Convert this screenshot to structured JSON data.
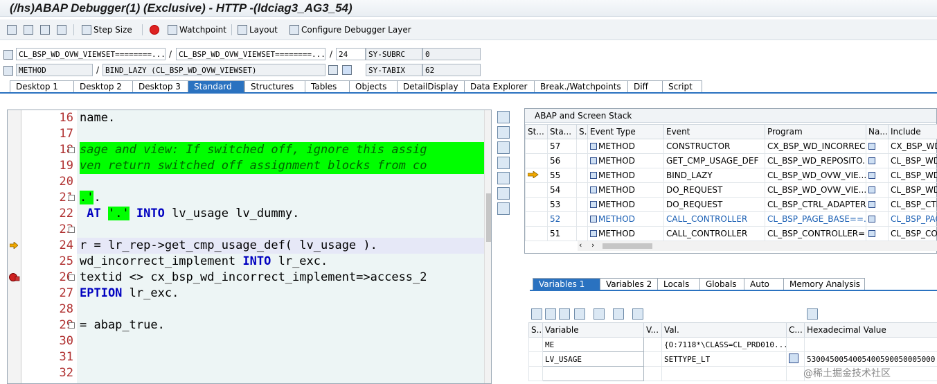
{
  "window": {
    "title": "(/hs)ABAP Debugger(1)  (Exclusive) - HTTP -(ldciag3_AG3_54)"
  },
  "toolbar": {
    "step_size": "Step Size",
    "watchpoint": "Watchpoint",
    "layout": "Layout",
    "configure": "Configure Debugger Layer"
  },
  "context": {
    "program_1": "CL_BSP_WD_OVW_VIEWSET========...",
    "program_2": "CL_BSP_WD_OVW_VIEWSET========...",
    "line": "24",
    "type": "METHOD",
    "name": "BIND_LAZY (CL_BSP_WD_OVW_VIEWSET)",
    "sysvars": [
      {
        "name": "SY-SUBRC",
        "value": "0"
      },
      {
        "name": "SY-TABIX",
        "value": "62"
      }
    ]
  },
  "tabs": [
    "Desktop 1",
    "Desktop 2",
    "Desktop 3",
    "Standard",
    "Structures",
    "Tables",
    "Objects",
    "DetailDisplay",
    "Data Explorer",
    "Break./Watchpoints",
    "Diff",
    "Script"
  ],
  "selected_tab": "Standard",
  "source": {
    "lines": [
      "16",
      "17",
      "18",
      "19",
      "20",
      "21",
      "22",
      "23",
      "24",
      "25",
      "26",
      "27",
      "28",
      "29",
      "30",
      "31",
      "32"
    ],
    "code": {
      "l16": "name.",
      "l18": "sage and view: If switched off, ignore this assig",
      "l19": "ven return switched off assignment blocks from co",
      "l21a": ".'",
      "l21b": ".",
      "l22a": " AT ",
      "l22b": "'.'",
      "l22c": " INTO",
      "l22d": " lv_usage lv_dummy.",
      "l24": "r = lr_rep->get_cmp_usage_def( lv_usage ).",
      "l25a": "wd_incorrect_implement ",
      "l25b": "INTO",
      "l25c": " lr_exc.",
      "l26": "textid <> cx_bsp_wd_incorrect_implement=>access_2",
      "l27a": "EPTION",
      "l27b": " lr_exc.",
      "l29": "= abap_true."
    }
  },
  "stack": {
    "title": "ABAP and Screen Stack",
    "headers": [
      "St...",
      "Sta...",
      "S...",
      "Event Type",
      "Event",
      "Program",
      "Na...",
      "Include"
    ],
    "rows": [
      {
        "level": "57",
        "type": "METHOD",
        "event": "CONSTRUCTOR",
        "program": "CX_BSP_WD_INCORREC...",
        "include": "CX_BSP_WD_"
      },
      {
        "level": "56",
        "type": "METHOD",
        "event": "GET_CMP_USAGE_DEF",
        "program": "CL_BSP_WD_REPOSITO...",
        "include": "CL_BSP_WD_"
      },
      {
        "level": "55",
        "type": "METHOD",
        "event": "BIND_LAZY",
        "program": "CL_BSP_WD_OVW_VIE...",
        "include": "CL_BSP_WD_"
      },
      {
        "level": "54",
        "type": "METHOD",
        "event": "DO_REQUEST",
        "program": "CL_BSP_WD_OVW_VIE...",
        "include": "CL_BSP_WD_"
      },
      {
        "level": "53",
        "type": "METHOD",
        "event": "DO_REQUEST",
        "program": "CL_BSP_CTRL_ADAPTER...",
        "include": "CL_BSP_CTR"
      },
      {
        "level": "52",
        "type": "METHOD",
        "event": "CALL_CONTROLLER",
        "program": "CL_BSP_PAGE_BASE==...",
        "include": "CL_BSP_PAG"
      },
      {
        "level": "51",
        "type": "METHOD",
        "event": "CALL_CONTROLLER",
        "program": "CL_BSP_CONTROLLER=...",
        "include": "CL_BSP_CON"
      }
    ]
  },
  "vars_tabs": [
    "Variables 1",
    "Variables 2",
    "Locals",
    "Globals",
    "Auto",
    "Memory Analysis"
  ],
  "vars": {
    "headers": [
      "S...",
      "Variable",
      "V...",
      "Val.",
      "C...",
      "Hexadecimal Value"
    ],
    "rows": [
      {
        "name": "ME",
        "value": "{O:7118*\\CLASS=CL_PRD010...",
        "hex": ""
      },
      {
        "name": "LV_USAGE",
        "value": "SETTYPE_LT",
        "hex": "5300450054005400590050005000"
      }
    ]
  },
  "watermark": "@稀土掘金技术社区"
}
